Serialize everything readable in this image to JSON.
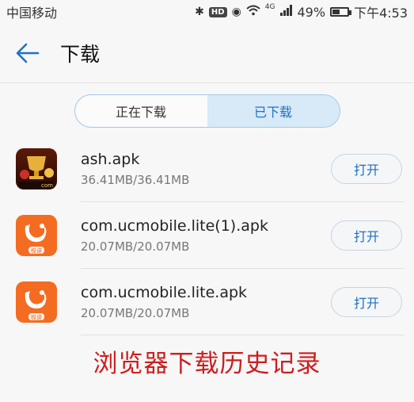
{
  "status_bar": {
    "carrier": "中国移动",
    "hd_badge": "HD",
    "network_tag": "4G",
    "battery": "49%",
    "battery_level": 0.49,
    "time": "下午4:53"
  },
  "app_bar": {
    "title": "下载"
  },
  "tabs": [
    {
      "label": "正在下载",
      "active": false
    },
    {
      "label": "已下载",
      "active": true
    }
  ],
  "downloads": [
    {
      "name": "ash.apk",
      "size": "36.41MB/36.41MB",
      "icon": "game-app-icon",
      "icon_text": "com",
      "action": "打开"
    },
    {
      "name": "com.ucmobile.lite(1).apk",
      "size": "20.07MB/20.07MB",
      "icon": "uc-browser-icon",
      "icon_text": "极速",
      "action": "打开"
    },
    {
      "name": "com.ucmobile.lite.apk",
      "size": "20.07MB/20.07MB",
      "icon": "uc-browser-icon",
      "icon_text": "极速",
      "action": "打开"
    }
  ],
  "caption": "浏览器下载历史记录",
  "colors": {
    "accent": "#1d73c9",
    "caption_red": "#cc1e1e",
    "uc_orange": "#f36c21"
  }
}
